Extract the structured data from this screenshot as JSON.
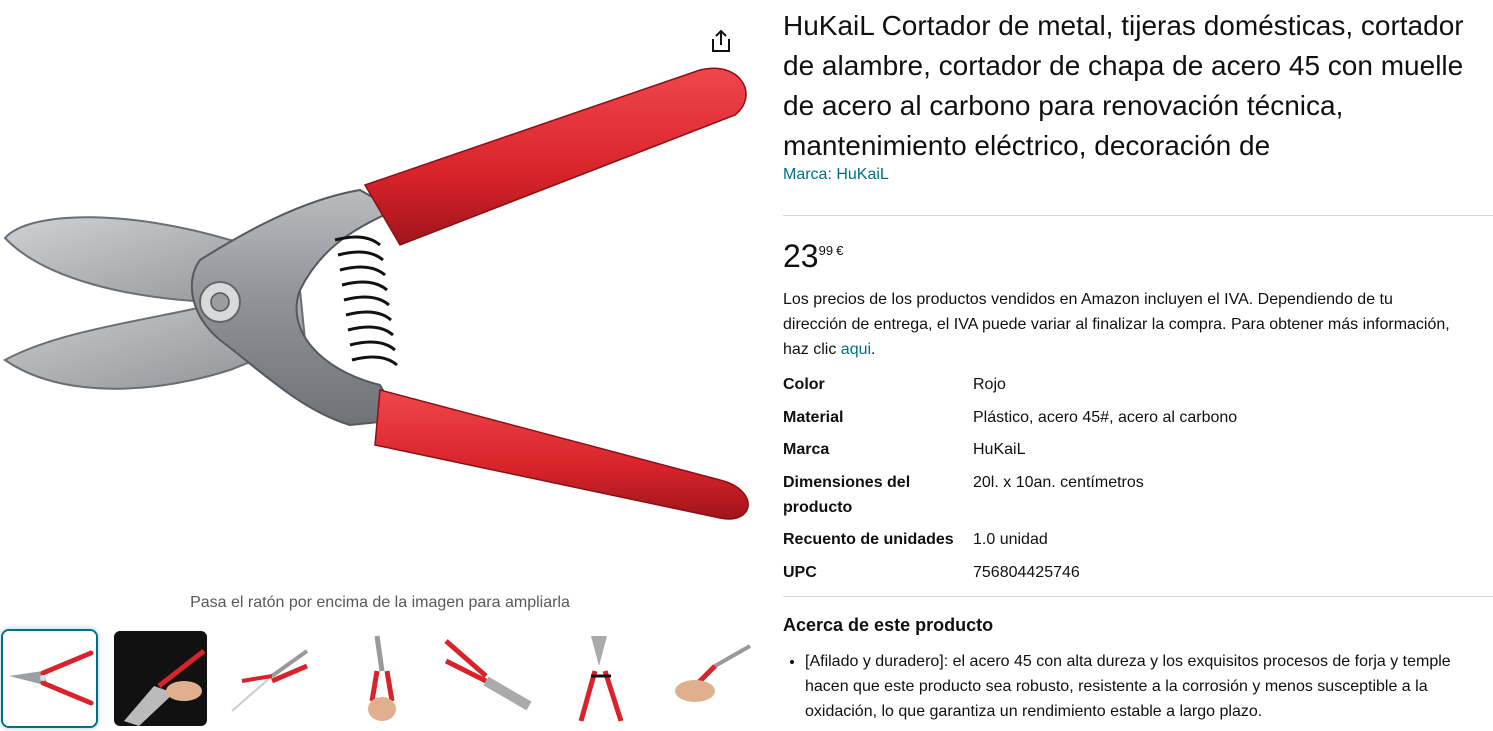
{
  "product": {
    "title": "HuKaiL Cortador de metal, tijeras domésticas, cortador de alambre, cortador de chapa de acero 45 con muelle de acero al carbono para renovación técnica, mantenimiento eléctrico, decoración de",
    "brand_link": "Marca: HuKaiL"
  },
  "price": {
    "whole": "23",
    "fraction": "99",
    "currency": "€"
  },
  "tax_note": {
    "text": "Los precios de los productos vendidos en Amazon incluyen el IVA. Dependiendo de tu dirección de entrega, el IVA puede variar al finalizar la compra. Para obtener más información, haz clic ",
    "link": "aqui",
    "end": "."
  },
  "specs": [
    {
      "label": "Color",
      "value": "Rojo"
    },
    {
      "label": "Material",
      "value": "Plástico, acero 45#, acero al carbono"
    },
    {
      "label": "Marca",
      "value": "HuKaiL"
    },
    {
      "label": "Dimensiones del producto",
      "value": "20l. x 10an. centímetros"
    },
    {
      "label": "Recuento de unidades",
      "value": "1.0 unidad"
    },
    {
      "label": "UPC",
      "value": "756804425746"
    }
  ],
  "gallery": {
    "zoom_hint": "Pasa el ratón por encima de la imagen para ampliarla",
    "thumbnail_count": 7,
    "selected_index": 0,
    "share_icon": "share-icon",
    "handle_color": "#d9232b",
    "accent_color": "#007185"
  },
  "about": {
    "title": "Acerca de este producto",
    "bullets": [
      "[Afilado y duradero]: el acero 45 con alta dureza y los exquisitos procesos de forja y temple hacen que este producto sea robusto, resistente a la corrosión y menos susceptible a la oxidación, lo que garantiza un rendimiento estable a largo plazo."
    ]
  }
}
